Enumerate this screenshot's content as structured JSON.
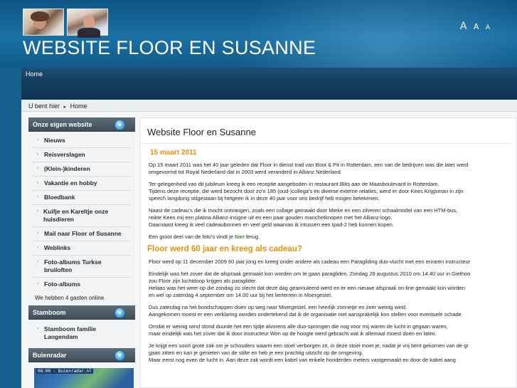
{
  "header": {
    "site_title": "WEBSITE FLOOR EN SUSANNE",
    "font_sizes": [
      "A",
      "A",
      "A"
    ]
  },
  "nav": {
    "home": "Home"
  },
  "breadcrumb": {
    "prefix": "U bent hier",
    "separator": "▸",
    "current": "Home"
  },
  "sidebar": {
    "section1": {
      "title": "Onze eigen website",
      "toggle_icon": "chevron-down-icon",
      "items": [
        "Nieuws",
        "Reisverslagen",
        "(Klein-)kinderen",
        "Vakantie en hobby",
        "Bloedbank",
        "Kuifje en Kareltje onze huisdieren",
        "Mail naar Floor of Susanne",
        "Weblinks",
        "Foto-albums Turkse bruiloften",
        "Foto-albums"
      ],
      "guests": "We hebben 4 gasten online"
    },
    "section2": {
      "title": "Stamboom",
      "items": [
        "Stamboom familie Langendam"
      ]
    },
    "section3": {
      "title": "Buienradar",
      "radar_label": "08:00 - Buienradar.nl"
    }
  },
  "main": {
    "title": "Website Floor en Susanne",
    "date": "15 maart 2011",
    "para1": [
      "Op 15 maart 2011 was het 40 jaar geleden dat Floor in dienst trad van Boot & Pit in Rotterdam, een van de bedrijven was die later werd",
      "omgevormd tot Royal Nederland dat in 2003 werd veranderd in Allianz Nederland."
    ],
    "para2": [
      "Ter gelegenheid van dit jubileum kreeg ik een receptie aangeboden in restaurant Blits aan de Maasboulevard in Rotterdam.",
      "Tijdens deze receptie, die werd bezocht door zo'n 185 (oud-)collega's en diverse externe relaties, werd er door Kees Krijgsman in zijn",
      "speech langdurig stilgestaan bij hetgeen ik in deze 40 jaar voor ons bedrijf heb mogen betekenen."
    ],
    "para3": [
      "Naast de cadeau's die ik mocht ontvangen, zoals een collage gemaakt door Mieke en een zilveren schaalmodel van een HTM-bus,",
      "reikte Kees mij een platina Allianz-insigne uit en een paar gouden manchetknopen met het Allianz-logo.",
      "Daarnaast kreeg ik veel cadeaubonnen en veel geld waarvan ik intussen een Ipad-2 heb kunnen kopen."
    ],
    "para4_prefix": "Een groot deel van de foto's vindt je ",
    "para4_link": "hier",
    "para4_suffix": " terug.",
    "heading2": "Floor werd 60 jaar en kreeg als cadeau?",
    "para5": "Floor werd op 11 december 2009 60 jaar jong en kreeg onder andere als cadeau een Paragliding duo-vlucht met een ervaren instructeur",
    "para6": [
      "Eindelijk was het zover dat de afspraak gemaakt kon worden om te gaan paragliden. Zondag 29 augustus 2010 om 14.40 uur in Giethoo",
      "zou Floor zijn luchtdoop krijgen als paraglider.",
      "Helaas was het weer op die zondag zo slecht dat deze dag geannuleerd werd en er een nieuwe afspraak on-line gemaakt kon worden",
      "en wel op zaterdag 4 september om 14.00 uur bij het lierterrein in Moergestel."
    ],
    "para7": [
      "Dus zaterdag na het boodschappen doen op weg naar Moergestel, een heerlijk zonnetje en zeer weinig wind.",
      "Aangekomen moest er een verklaring worden ondertekend dat ik de organisatie niet aansprakelijk kon stellen voor eventuele schade."
    ],
    "para8": [
      "Omdat er weinig wind stond duurde het een tijdje alvorens alle duo-sprongen die nog voor mij waren de lucht in gegaan waren,",
      "maar eindelijk was het zover dat ik door instructeur Wim op de hoogte werd gebracht wat ik allemaal moest doen en laten."
    ],
    "para9": [
      "Je krijgt een soort grote zak om je schouders waarin een stoel verborgen zit, in deze stoel moet je, nadat je vrij bent gekomen van de gr",
      "gaan zitten en kan je genieten van de stilte en heb je een prachtig uitzicht op de omgeving.",
      "Maar eerst nog even de lucht in. Aan deze zak wordt een kabel van enkele honderden meters vastgemaakt en door de kabel aang"
    ]
  }
}
